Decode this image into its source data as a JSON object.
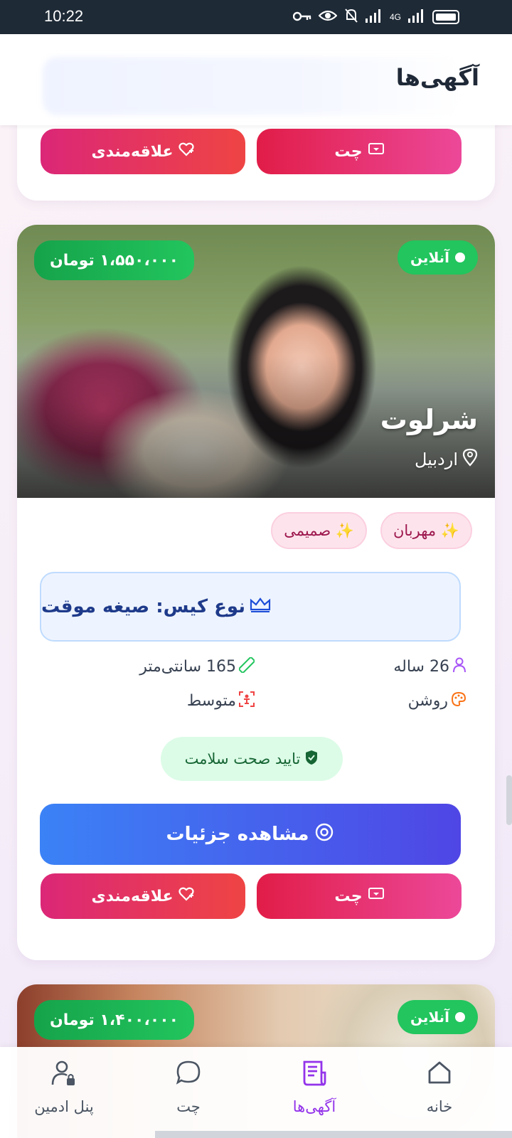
{
  "status_bar": {
    "time": "10:22",
    "network_label": "4G"
  },
  "header": {
    "title": "آگهی‌ها"
  },
  "top_card": {
    "chat_label": "چت",
    "fav_label": "علاقه‌مندی"
  },
  "main_card": {
    "status": "آنلاین",
    "price": "۱،۵۵۰،۰۰۰ تومان",
    "name": "شرلوت",
    "city": "اردبیل",
    "tags": [
      "✨ مهربان",
      "✨ صمیمی"
    ],
    "case_label": "نوع کیس: صیغه موقت",
    "attributes": {
      "age": "26 ساله",
      "height": "165 سانتی‌متر",
      "skin": "روشن",
      "body": "متوسط"
    },
    "health": "تایید صحت سلامت",
    "details_label": "مشاهده جزئیات",
    "chat_label": "چت",
    "fav_label": "علاقه‌مندی"
  },
  "bottom_card": {
    "status": "آنلاین",
    "price": "۱،۴۰۰،۰۰۰ تومان"
  },
  "bottom_nav": {
    "items": [
      {
        "label": "خانه",
        "icon": "home-icon"
      },
      {
        "label": "آگهی‌ها",
        "icon": "ads-icon",
        "active": true
      },
      {
        "label": "چت",
        "icon": "chat-icon"
      },
      {
        "label": "پنل ادمین",
        "icon": "admin-icon"
      }
    ]
  },
  "colors": {
    "accent": "#9333ea",
    "green": "#22c55e",
    "pink": "#ec4899",
    "blue": "#3b82f6"
  }
}
